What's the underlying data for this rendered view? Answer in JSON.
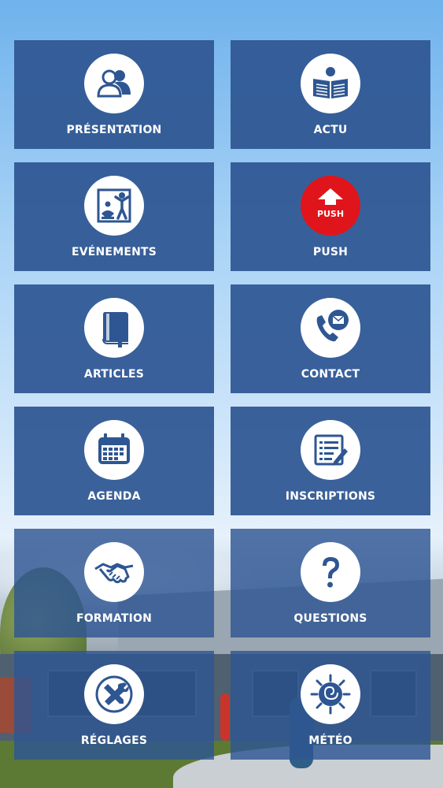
{
  "tiles": [
    {
      "label": "PRÉSENTATION",
      "icon": "people-icon"
    },
    {
      "label": "ACTU",
      "icon": "newspaper-icon"
    },
    {
      "label": "EVÉNEMENTS",
      "icon": "events-icon"
    },
    {
      "label": "PUSH",
      "icon": "push-icon",
      "icon_text": "PUSH",
      "icon_color": "#e0151b"
    },
    {
      "label": "ARTICLES",
      "icon": "book-icon"
    },
    {
      "label": "CONTACT",
      "icon": "phone-mail-icon"
    },
    {
      "label": "AGENDA",
      "icon": "calendar-icon"
    },
    {
      "label": "INSCRIPTIONS",
      "icon": "form-pencil-icon"
    },
    {
      "label": "FORMATION",
      "icon": "handshake-icon"
    },
    {
      "label": "QUESTIONS",
      "icon": "question-icon"
    },
    {
      "label": "RÉGLAGES",
      "icon": "tools-icon"
    },
    {
      "label": "MÉTÉO",
      "icon": "sun-icon"
    }
  ],
  "colors": {
    "tile": "#2e5692",
    "icon_fg": "#2e5692",
    "push_red": "#e0151b"
  }
}
